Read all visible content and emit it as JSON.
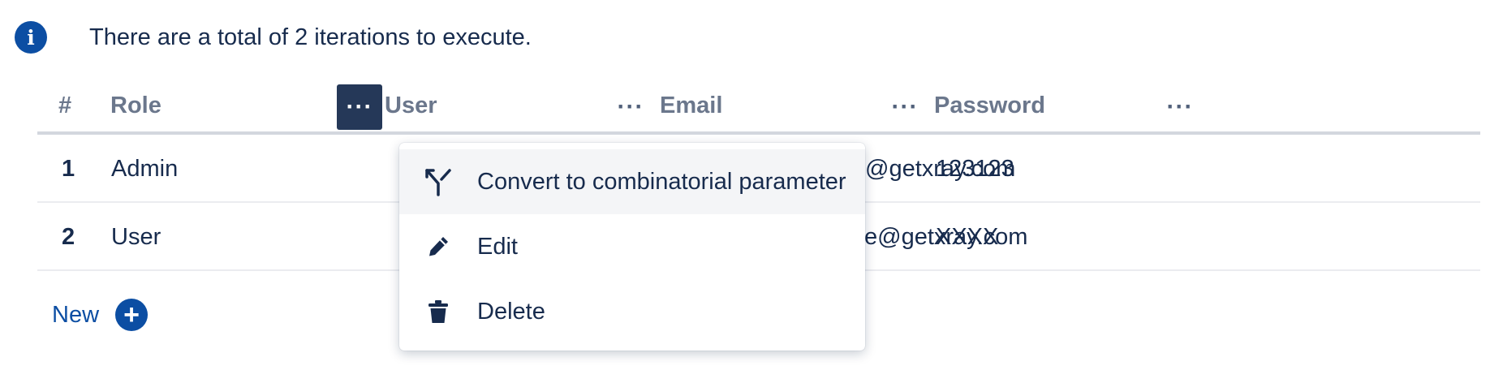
{
  "info": {
    "icon": "info-icon",
    "message": "There are a total of 2 iterations to execute."
  },
  "table": {
    "columns": {
      "num": "#",
      "role": "Role",
      "user": "User",
      "email": "Email",
      "password": "Password"
    },
    "column_menu_icon": "···",
    "rows": [
      {
        "num": "1",
        "role": "Admin",
        "email": "@getxray.com",
        "password": "123123"
      },
      {
        "num": "2",
        "role": "User",
        "email": "e@getxray.com",
        "password": "XXXX"
      }
    ]
  },
  "new_button": {
    "label": "New",
    "icon": "+"
  },
  "context_menu": {
    "items": [
      {
        "label": "Convert to combinatorial parameter",
        "icon": "split-arrow-icon"
      },
      {
        "label": "Edit",
        "icon": "pencil-icon"
      },
      {
        "label": "Delete",
        "icon": "trash-icon"
      }
    ]
  },
  "colors": {
    "accent": "#0c4ea3",
    "header_text": "#6b778c",
    "active_menu_button": "#253858",
    "body_text": "#172b4d"
  }
}
